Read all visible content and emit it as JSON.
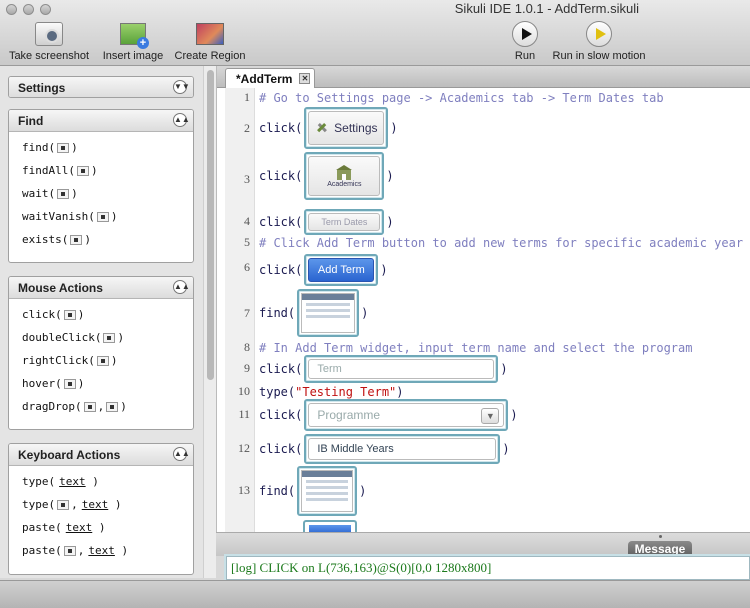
{
  "window": {
    "title": "Sikuli IDE 1.0.1 - AddTerm.sikuli"
  },
  "toolbar": {
    "take_screenshot": "Take screenshot",
    "insert_image": "Insert image",
    "create_region": "Create Region",
    "run": "Run",
    "run_slow": "Run in slow motion"
  },
  "sidebar": {
    "settings": {
      "title": "Settings"
    },
    "find": {
      "title": "Find",
      "items": [
        "find(",
        "findAll(",
        "wait(",
        "waitVanish(",
        "exists("
      ]
    },
    "mouse": {
      "title": "Mouse Actions",
      "items": [
        "click(",
        "doubleClick(",
        "rightClick(",
        "hover(",
        "dragDrop("
      ]
    },
    "keyboard": {
      "title": "Keyboard Actions",
      "items": [
        "type(",
        "type(",
        "paste(",
        "paste("
      ],
      "text_arg": "text"
    }
  },
  "editor": {
    "tab": "*AddTerm",
    "lines": [
      {
        "n": "1",
        "comment": "# Go to Settings page -> Academics tab -> Term Dates tab"
      },
      {
        "n": "2",
        "fn": "click(",
        "img": "Settings"
      },
      {
        "n": "3",
        "fn": "click(",
        "img": "Academics"
      },
      {
        "n": "4",
        "fn": "click(",
        "img": "Term Dates"
      },
      {
        "n": "5",
        "comment": "# Click Add Term button to add new terms for specific academic year"
      },
      {
        "n": "6",
        "fn": "click(",
        "img": "Add Term"
      },
      {
        "n": "7",
        "fn": "find("
      },
      {
        "n": "8",
        "comment": "# In Add Term widget, input term name and select the program"
      },
      {
        "n": "9",
        "fn": "click(",
        "img": "Term"
      },
      {
        "n": "10",
        "fn": "type(",
        "str": "\"Testing Term\""
      },
      {
        "n": "11",
        "fn": "click(",
        "img": "Programme"
      },
      {
        "n": "12",
        "fn": "click(",
        "img": "IB Middle Years"
      },
      {
        "n": "13",
        "fn": "find("
      }
    ],
    "close_paren": ")"
  },
  "message": {
    "tab": "Message",
    "log": "[log] CLICK on L(736,163)@S(0)[0,0 1280x800]"
  }
}
